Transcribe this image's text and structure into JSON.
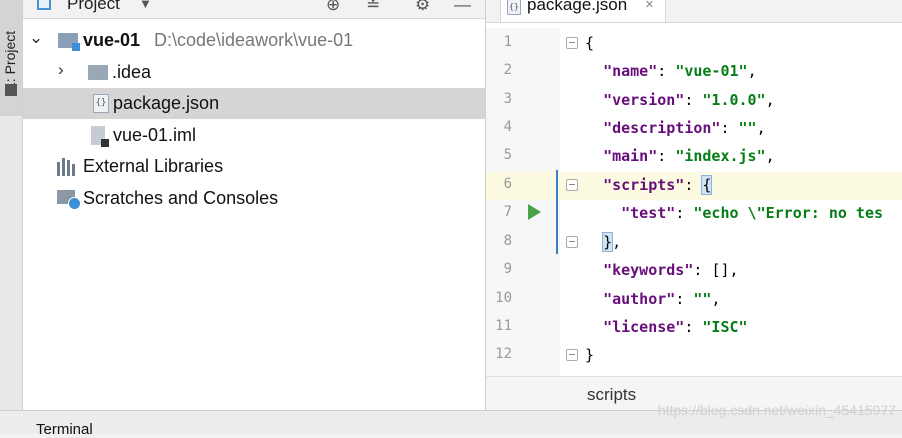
{
  "side_strip": {
    "tab_label": "1: Project"
  },
  "project_panel": {
    "title": "Project",
    "tree": [
      {
        "name": "vue-01",
        "path": "D:\\code\\ideawork\\vue-01"
      },
      {
        "name": ".idea"
      },
      {
        "name": "package.json"
      },
      {
        "name": "vue-01.iml"
      },
      {
        "name": "External Libraries"
      },
      {
        "name": "Scratches and Consoles"
      }
    ]
  },
  "editor": {
    "tab": {
      "label": "package.json",
      "close": "×"
    },
    "lines": [
      {
        "n": "1",
        "text": "{"
      },
      {
        "n": "2",
        "key": "\"name\"",
        "sep": ": ",
        "val": "\"vue-01\"",
        "end": ","
      },
      {
        "n": "3",
        "key": "\"version\"",
        "sep": ": ",
        "val": "\"1.0.0\"",
        "end": ","
      },
      {
        "n": "4",
        "key": "\"description\"",
        "sep": ": ",
        "val": "\"\"",
        "end": ","
      },
      {
        "n": "5",
        "key": "\"main\"",
        "sep": ": ",
        "val": "\"index.js\"",
        "end": ","
      },
      {
        "n": "6",
        "key": "\"scripts\"",
        "sep": ": ",
        "val": "{",
        "end": ""
      },
      {
        "n": "7",
        "key": "\"test\"",
        "sep": ": ",
        "val": "\"echo \\\"Error: no tes",
        "end": ""
      },
      {
        "n": "8",
        "text": "}",
        "end": ","
      },
      {
        "n": "9",
        "key": "\"keywords\"",
        "sep": ": ",
        "val": "[]",
        "end": ","
      },
      {
        "n": "10",
        "key": "\"author\"",
        "sep": ": ",
        "val": "\"\"",
        "end": ","
      },
      {
        "n": "11",
        "key": "\"license\"",
        "sep": ": ",
        "val": "\"ISC\"",
        "end": ""
      },
      {
        "n": "12",
        "text": "}"
      }
    ],
    "breadcrumb": "scripts"
  },
  "bottom": {
    "terminal_label": "Terminal"
  },
  "watermark": "https://blog.csdn.net/weixin_45415977"
}
